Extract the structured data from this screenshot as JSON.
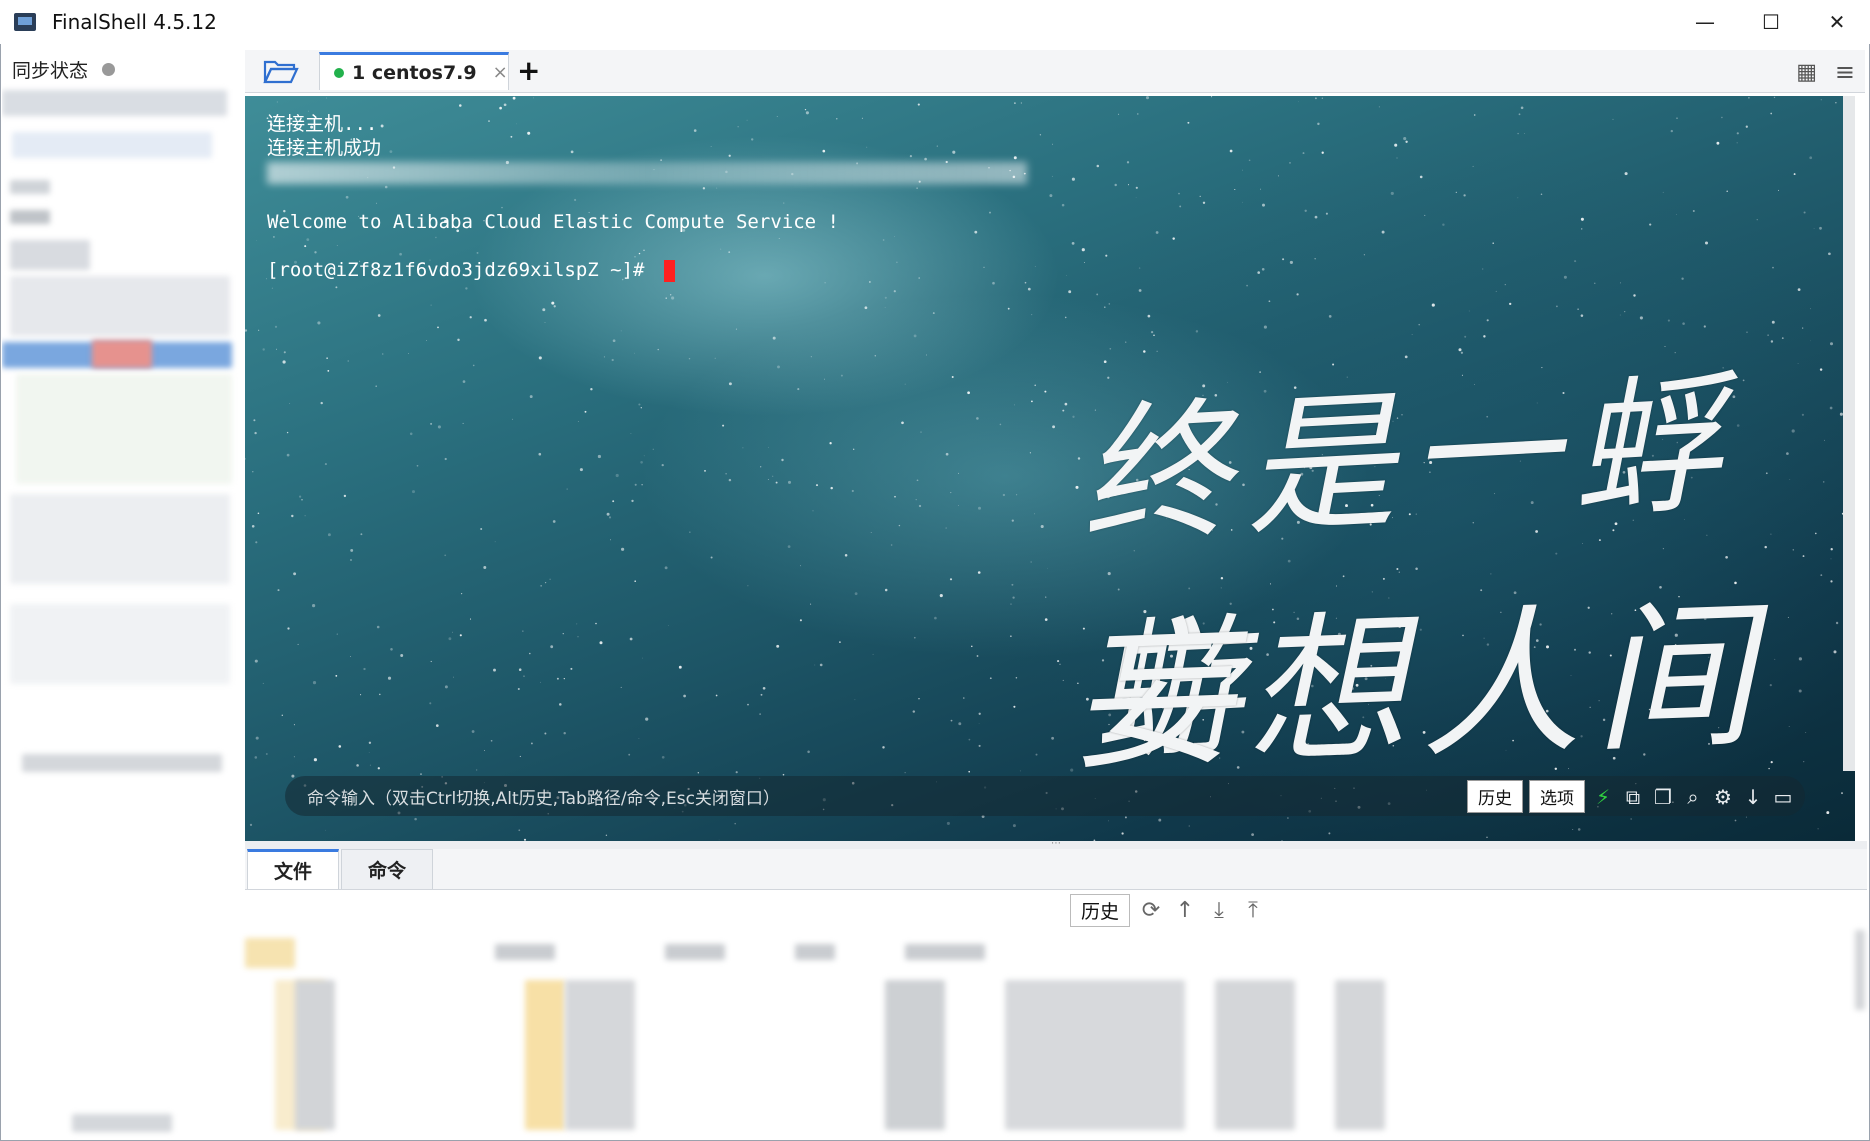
{
  "window": {
    "title": "FinalShell 4.5.12",
    "controls": {
      "minimize": "—",
      "maximize": "☐",
      "close": "✕"
    }
  },
  "sidebar": {
    "sync_label": "同步状态"
  },
  "tabbar": {
    "tabs": [
      {
        "label": "1 centos7.9",
        "status_color": "#22b14c",
        "close": "×"
      }
    ],
    "add_tab": "+",
    "icons": [
      "folder-open-icon",
      "grid-view-icon",
      "menu-icon"
    ]
  },
  "terminal": {
    "lines": [
      "连接主机...",
      "连接主机成功",
      "Welcome to Alibaba Cloud Elastic Compute Service !",
      "[root@iZf8z1f6vdo3jdz69xilspZ ~]# "
    ],
    "background_text_line1": "终是一蜉蝣",
    "background_text_line2": "妄想人间事",
    "cursor_color": "#ff2020"
  },
  "command_bar": {
    "hint": "命令输入（双击Ctrl切换,Alt历史,Tab路径/命令,Esc关闭窗口）",
    "history_button": "历史",
    "options_button": "选项",
    "icons": [
      "lightning-icon",
      "copy-icon",
      "paste-icon",
      "search-icon",
      "gear-icon",
      "download-icon",
      "maximize-icon"
    ]
  },
  "bottom_panel": {
    "tabs": [
      {
        "label": "文件",
        "active": true
      },
      {
        "label": "命令",
        "active": false
      }
    ],
    "history_button": "历史",
    "icons": [
      "refresh-icon",
      "up-arrow-icon",
      "download-icon",
      "upload-icon"
    ]
  }
}
